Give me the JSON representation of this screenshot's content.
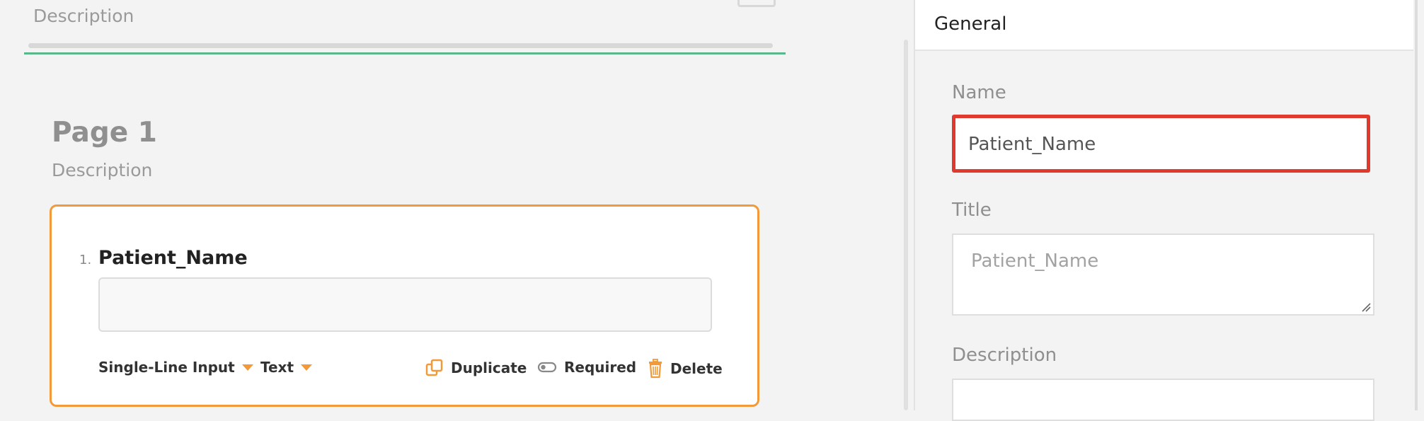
{
  "canvas": {
    "survey_description": "Description",
    "page": {
      "title": "Page 1",
      "description": "Description"
    },
    "question": {
      "number": "1.",
      "title": "Patient_Name",
      "input_value": "",
      "type_label": "Single-Line Input",
      "input_type_label": "Text",
      "duplicate_label": "Duplicate",
      "required_label": "Required",
      "delete_label": "Delete"
    }
  },
  "properties_panel": {
    "header": "General",
    "name_label": "Name",
    "name_value": "Patient_Name",
    "title_label": "Title",
    "title_placeholder": "Patient_Name",
    "description_label": "Description",
    "description_value": ""
  },
  "colors": {
    "accent_orange": "#f29a3a",
    "progress_green": "#5ab78a",
    "highlight_red": "#e0392d"
  },
  "icons": {
    "duplicate": "duplicate-icon",
    "required": "toggle-icon",
    "delete": "trash-icon",
    "dropdown": "caret-down-icon"
  }
}
